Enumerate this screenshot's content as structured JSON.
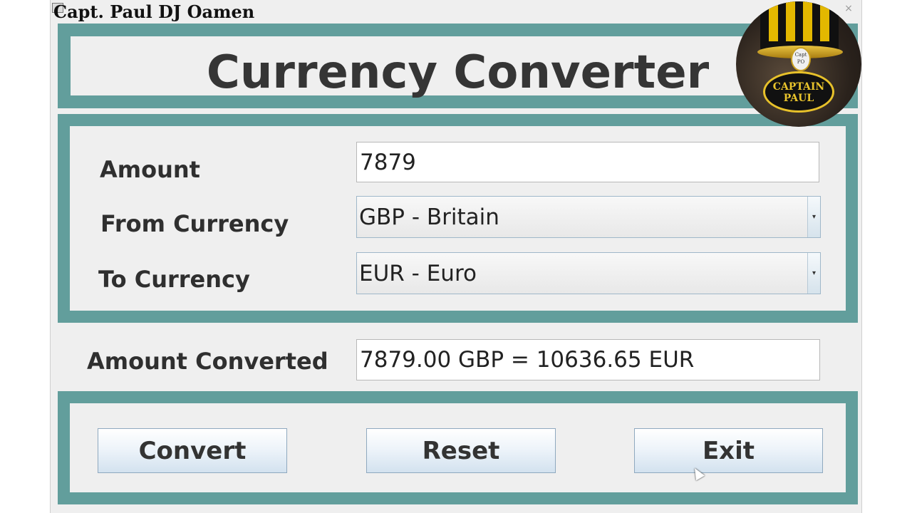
{
  "window": {
    "title": "Capt. Paul DJ Oamen",
    "close_glyph": "×"
  },
  "header": {
    "title": "Currency Converter"
  },
  "form": {
    "amount_label": "Amount",
    "amount_value": "7879",
    "from_label": "From Currency",
    "from_value": "GBP - Britain",
    "to_label": "To Currency",
    "to_value": "EUR - Euro"
  },
  "result": {
    "label": "Amount Converted",
    "value": "7879.00 GBP = 10636.65 EUR"
  },
  "buttons": {
    "convert": "Convert",
    "reset": "Reset",
    "exit": "Exit"
  },
  "badge": {
    "emblem_text": "Capt PO",
    "text_line1": "CAPTAIN",
    "text_line2": "PAUL"
  },
  "colors": {
    "frame_teal": "#629e9c",
    "panel_bg": "#efefef",
    "button_gradient_end": "#d3e2ef",
    "badge_gold": "#e3b800"
  },
  "icons": {
    "window_icon": "app-icon",
    "close": "close-icon",
    "dropdown": "chevron-down-icon"
  }
}
